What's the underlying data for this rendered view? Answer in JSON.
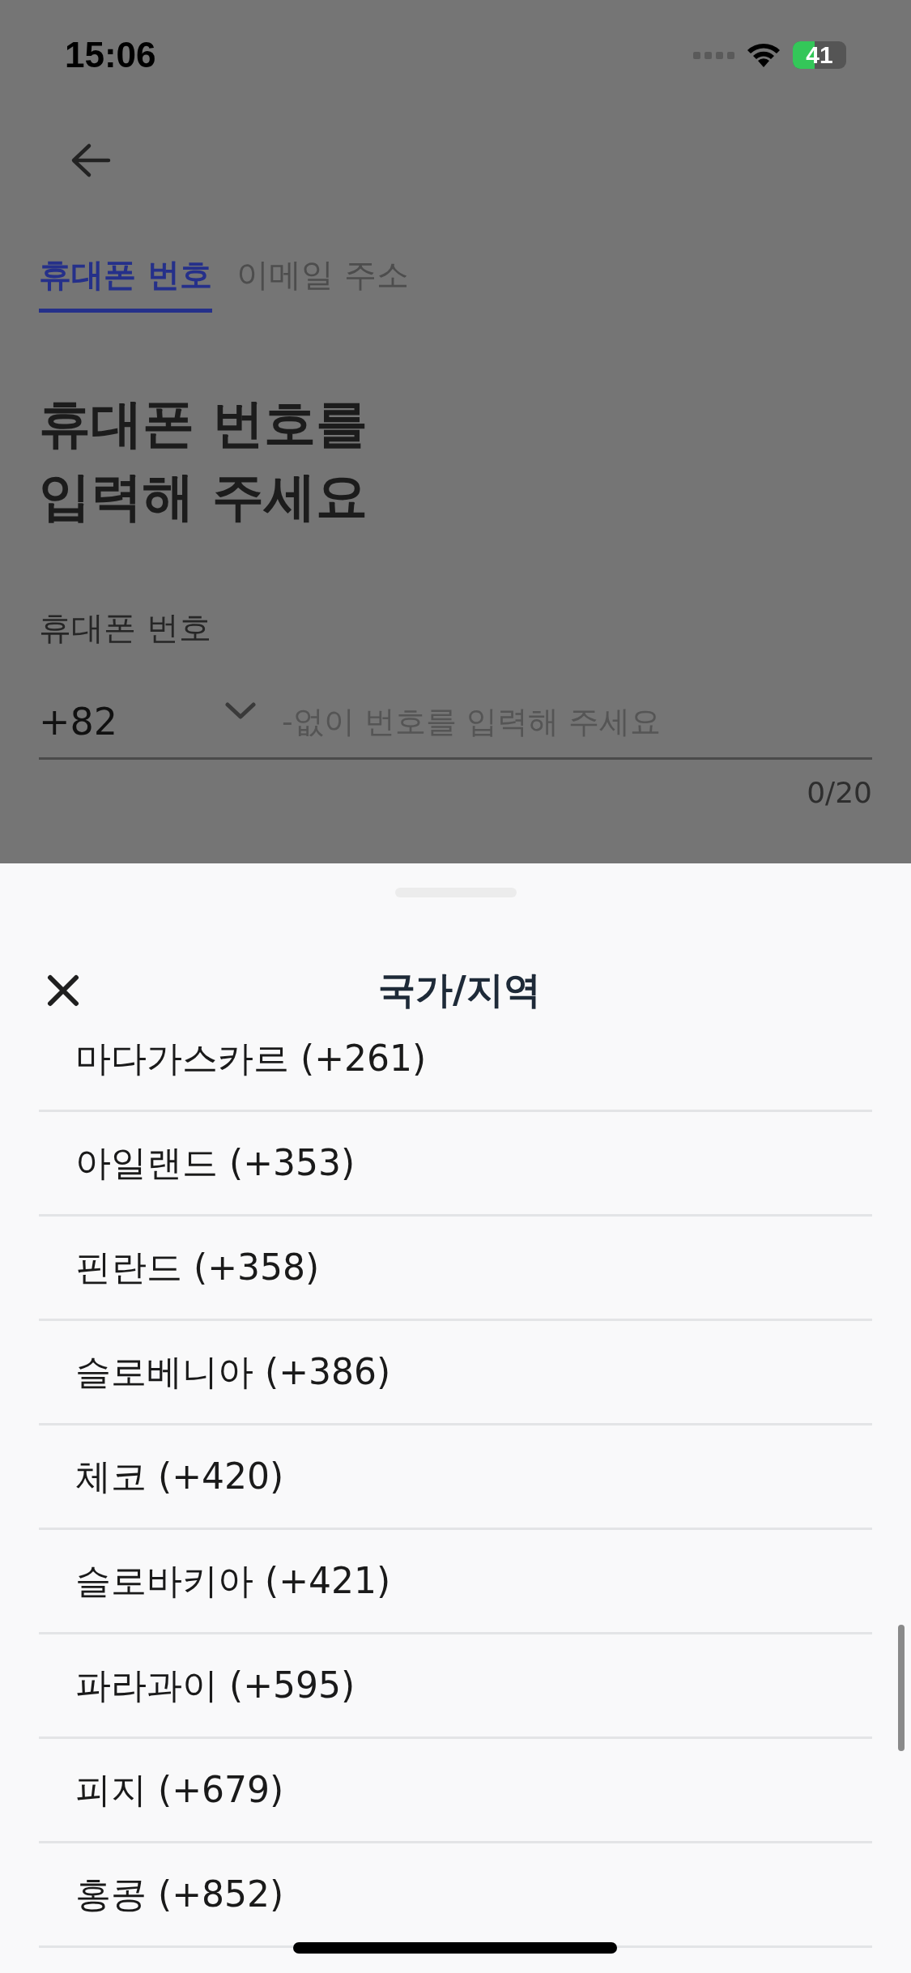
{
  "status_bar": {
    "time": "15:06",
    "battery": "41"
  },
  "tabs": [
    {
      "label": "휴대폰 번호",
      "selected": true
    },
    {
      "label": "이메일 주소",
      "selected": false
    }
  ],
  "heading": "휴대폰 번호를\n입력해 주세요",
  "field_label": "휴대폰 번호",
  "phone_field": {
    "country_code": "+82",
    "placeholder": "-없이 번호를 입력해 주세요",
    "counter": "0/20"
  },
  "sheet": {
    "title": "국가/지역",
    "countries": [
      "마다가스카르 (+261)",
      "아일랜드 (+353)",
      "핀란드 (+358)",
      "슬로베니아 (+386)",
      "체코 (+420)",
      "슬로바키아 (+421)",
      "파라과이 (+595)",
      "피지 (+679)",
      "홍콩 (+852)"
    ]
  }
}
